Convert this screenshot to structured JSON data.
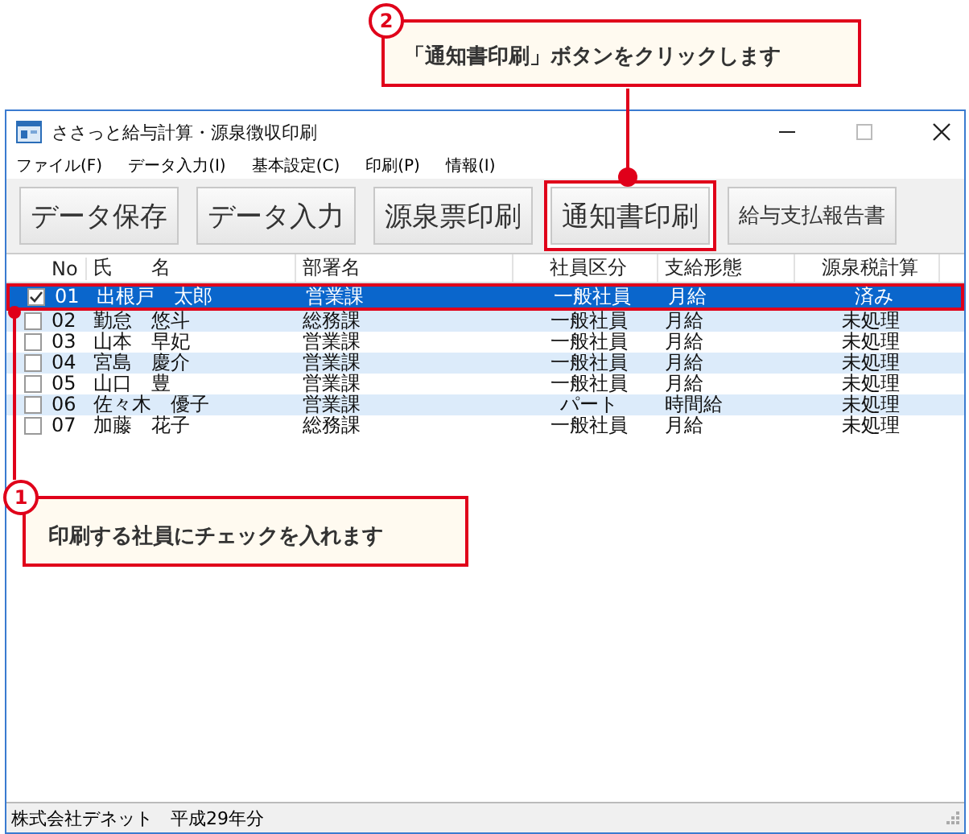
{
  "window": {
    "title": "ささっと給与計算・源泉徴収印刷"
  },
  "menu": [
    "ファイル(F)",
    "データ入力(I)",
    "基本設定(C)",
    "印刷(P)",
    "情報(I)"
  ],
  "toolbar": [
    {
      "label": "データ保存",
      "kind": "large",
      "highlighted": false
    },
    {
      "label": "データ入力",
      "kind": "large",
      "highlighted": false
    },
    {
      "label": "源泉票印刷",
      "kind": "large",
      "highlighted": false
    },
    {
      "label": "通知書印刷",
      "kind": "large",
      "highlighted": true
    },
    {
      "label": "給与支払報告書",
      "kind": "small",
      "highlighted": false
    }
  ],
  "table": {
    "columns": [
      "No",
      "氏　　名",
      "部署名",
      "社員区分",
      "支給形態",
      "源泉税計算"
    ],
    "rows": [
      {
        "checked": true,
        "selected": true,
        "cells": [
          "01",
          "出根戸　太郎",
          "営業課",
          "一般社員",
          "月給",
          "済み"
        ]
      },
      {
        "checked": false,
        "selected": false,
        "cells": [
          "02",
          "勤怠　悠斗",
          "総務課",
          "一般社員",
          "月給",
          "未処理"
        ]
      },
      {
        "checked": false,
        "selected": false,
        "cells": [
          "03",
          "山本　早妃",
          "営業課",
          "一般社員",
          "月給",
          "未処理"
        ]
      },
      {
        "checked": false,
        "selected": false,
        "cells": [
          "04",
          "宮島　慶介",
          "営業課",
          "一般社員",
          "月給",
          "未処理"
        ]
      },
      {
        "checked": false,
        "selected": false,
        "cells": [
          "05",
          "山口　豊",
          "営業課",
          "一般社員",
          "月給",
          "未処理"
        ]
      },
      {
        "checked": false,
        "selected": false,
        "cells": [
          "06",
          "佐々木　優子",
          "営業課",
          "パート",
          "時間給",
          "未処理"
        ]
      },
      {
        "checked": false,
        "selected": false,
        "cells": [
          "07",
          "加藤　花子",
          "総務課",
          "一般社員",
          "月給",
          "未処理"
        ]
      }
    ]
  },
  "status_bar": "株式会社デネット　平成29年分",
  "callouts": [
    {
      "number": "2",
      "text": "「通知書印刷」ボタンをクリックします"
    },
    {
      "number": "1",
      "text": "印刷する社員にチェックを入れます"
    }
  ]
}
